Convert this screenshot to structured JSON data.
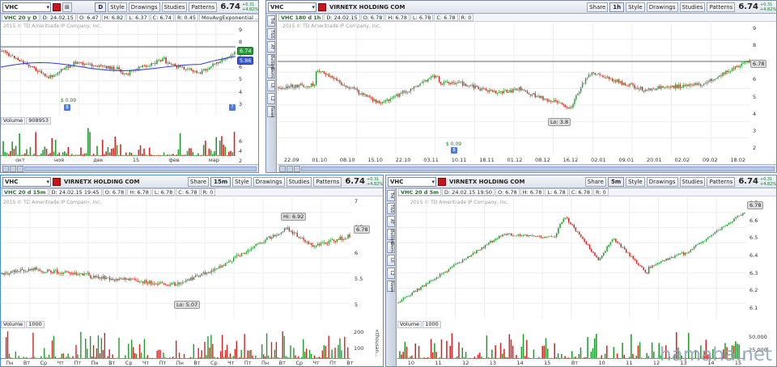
{
  "panels": {
    "p1": {
      "symbol": "VHC",
      "period_btn": "D",
      "style": "Style",
      "drawings": "Drawings",
      "studies": "Studies",
      "patterns": "Patterns",
      "price": "6.74",
      "change_abs": "+0.31",
      "change_pct": "+4.82%",
      "info": [
        "VHC 20 y D",
        "D: 24.02.15",
        "O: 6.47",
        "H: 6.82",
        "L: 6.37",
        "C: 6.74",
        "R: 0.45",
        "MovAvgExponential ..."
      ],
      "copyright": "2015 © TD Ameritrade IP Company, Inc.",
      "y_ticks": [
        "9",
        "8",
        "7",
        "6",
        "5",
        "4",
        "3"
      ],
      "price_label": "6.74",
      "ma_label": "5.86",
      "dividend": "$ 0.09",
      "volume_label": "Volume",
      "volume_value": "908953",
      "vol_ticks": [
        "6",
        "4",
        "2"
      ],
      "x_ticks": [
        "окт",
        "ноя",
        "дек",
        "15",
        "фев",
        "мар"
      ]
    },
    "p2": {
      "symbol": "VHC",
      "company": "VIRNETX HOLDING COM",
      "share": "Share",
      "period_btn": "1h",
      "style": "Style",
      "drawings": "Drawings",
      "studies": "Studies",
      "patterns": "Patterns",
      "price": "6.74",
      "change_abs": "+0.31",
      "change_pct": "+4.82%",
      "info": [
        "VHC 180 d 1h",
        "D: 24.02.15",
        "O: 6.78",
        "H: 6.78",
        "L: 6.78",
        "C: 6.78",
        "R: 0"
      ],
      "copyright": "2015 © TD Ameritrade IP Company, Inc.",
      "y_ticks": [
        "9",
        "8",
        "7",
        "6",
        "5",
        "4",
        "3",
        "2"
      ],
      "price_label": "6.78",
      "lo_label": "Lo: 3.8",
      "dividend": "$ 0.09",
      "side_label": "<millions>",
      "x_ticks": [
        "22.09",
        "01.10",
        "08.10",
        "15.10",
        "22.10",
        "03.11",
        "10.11",
        "18.11",
        "01.12",
        "08.12",
        "16.12",
        "02.01",
        "09.01",
        "20.01",
        "02.02",
        "09.02",
        "18.02"
      ]
    },
    "p3": {
      "symbol": "VHC",
      "company": "VIRNETX HOLDING COM",
      "share": "Share",
      "period_btn": "15m",
      "style": "Style",
      "drawings": "Drawings",
      "studies": "Studies",
      "patterns": "Patterns",
      "price": "6.74",
      "change_abs": "+0.31",
      "change_pct": "+4.82%",
      "info": [
        "VHC 20 d 15m",
        "D: 24.02.15 19:45",
        "O: 6.78",
        "H: 6.78",
        "L: 6.78",
        "C: 6.78",
        "R: 0"
      ],
      "copyright": "2015 © TD Ameritrade IP Company, Inc.",
      "y_ticks": [
        "7",
        "6.5",
        "6",
        "5.5",
        "5"
      ],
      "price_label": "6.78",
      "hi_label": "Hi: 6.92",
      "lo_label": "Lo: 5.07",
      "volume_label": "Volume",
      "volume_value": "1000",
      "vol_ticks": [
        "200",
        "100"
      ],
      "side_label": "<thousan...",
      "x_ticks": [
        "Пн",
        "Вт",
        "Ср",
        "Чт",
        "Пт",
        "Пн",
        "Вт",
        "Ср",
        "Чт",
        "Пт",
        "Пн",
        "Вт",
        "Ср",
        "Чт",
        "Пт",
        "Пн",
        "Вт",
        "Ср",
        "Чт",
        "Пт",
        "Вт"
      ]
    },
    "p4": {
      "symbol": "VHC",
      "company": "VIRNETX HOLDING COM",
      "share": "Share",
      "period_btn": "5m",
      "style": "Style",
      "drawings": "Drawings",
      "studies": "Studies",
      "patterns": "Patterns",
      "price": "6.74",
      "change_abs": "+0.31",
      "change_pct": "+4.82%",
      "info": [
        "VHC 20 d 5m",
        "D: 24.02.15 19:50",
        "O: 6.78",
        "H: 6.78",
        "L: 6.78",
        "C: 6.78",
        "R: 0"
      ],
      "copyright": "2015 © TD Ameritrade IP Company, Inc.",
      "y_ticks": [
        "6.7",
        "6.6",
        "6.5",
        "6.4",
        "6.3",
        "6.2",
        "6.1"
      ],
      "price_label": "6.78",
      "volume_label": "Volume",
      "volume_value": "1000",
      "vol_ticks": [
        "50,000",
        "25,000"
      ],
      "x_ticks": [
        "10",
        "11",
        "12",
        "13",
        "14",
        "15",
        "Вт",
        "10",
        "11",
        "12",
        "13",
        "14",
        "15"
      ]
    }
  },
  "side_tabs_left": [
    "Trd",
    "T&S",
    "AT",
    "Buttons",
    "Dom",
    "LII",
    "L2",
    "News"
  ],
  "watermark": "hamaha.net"
}
